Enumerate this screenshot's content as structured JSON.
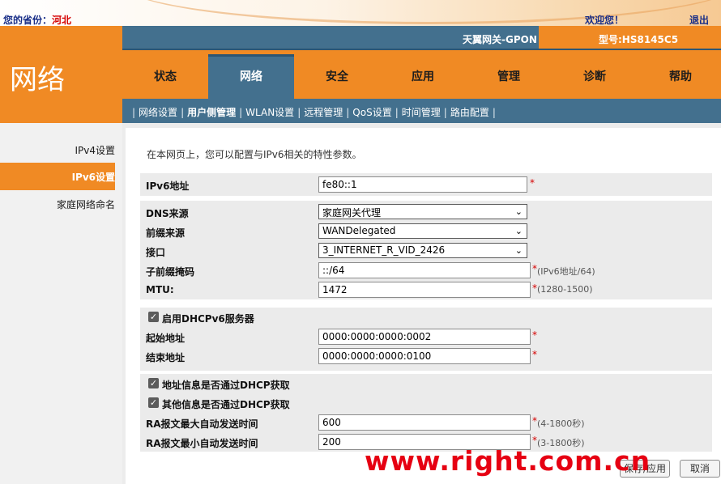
{
  "topbar": {
    "province_label": "您的省份：",
    "province_value": "河北",
    "welcome": "欢迎您！",
    "logout": "退出"
  },
  "header": {
    "section_title": "网络",
    "device_name": "天翼网关-GPON",
    "model_label": "型号:HS8145C5"
  },
  "nav": {
    "tabs": [
      "状态",
      "网络",
      "安全",
      "应用",
      "管理",
      "诊断",
      "帮助"
    ],
    "active": "网络"
  },
  "subnav": {
    "items": [
      "网络设置",
      "用户侧管理",
      "WLAN设置",
      "远程管理",
      "QoS设置",
      "时间管理",
      "路由配置"
    ],
    "active": "用户侧管理"
  },
  "sidebar": {
    "items": [
      "IPv4设置",
      "IPv6设置",
      "家庭网络命名"
    ],
    "active": "IPv6设置"
  },
  "form": {
    "intro": "在本网页上，您可以配置与IPv6相关的特性参数。",
    "ipv6_address": {
      "label": "IPv6地址",
      "value": "fe80::1",
      "required": "*"
    },
    "dns_source": {
      "label": "DNS来源",
      "value": "家庭网关代理"
    },
    "prefix_source": {
      "label": "前缀来源",
      "value": "WANDelegated"
    },
    "interface": {
      "label": "接口",
      "value": "3_INTERNET_R_VID_2426"
    },
    "subprefix_mask": {
      "label": "子前缀掩码",
      "value": "::/64",
      "required": "*",
      "hint": "(IPv6地址/64)"
    },
    "mtu": {
      "label": "MTU:",
      "value": "1472",
      "required": "*",
      "hint": "(1280-1500)"
    },
    "dhcpv6": {
      "label": "启用DHCPv6服务器",
      "checked": true
    },
    "start_address": {
      "label": "起始地址",
      "value": "0000:0000:0000:0002",
      "required": "*"
    },
    "end_address": {
      "label": "结束地址",
      "value": "0000:0000:0000:0100",
      "required": "*"
    },
    "addr_via_dhcp": {
      "label": "地址信息是否通过DHCP获取",
      "checked": true
    },
    "other_via_dhcp": {
      "label": "其他信息是否通过DHCP获取",
      "checked": true
    },
    "ra_max": {
      "label": "RA报文最大自动发送时间",
      "value": "600",
      "required": "*",
      "hint": "(4-1800秒)"
    },
    "ra_min": {
      "label": "RA报文最小自动发送时间",
      "value": "200",
      "required": "*",
      "hint": "(3-1800秒)"
    }
  },
  "buttons": {
    "apply": "保存/应用",
    "cancel": "取消"
  },
  "watermark": "www.right.com.cn",
  "colors": {
    "orange": "#f08a24",
    "steel_blue": "#43708e",
    "required_red": "#d40000"
  }
}
